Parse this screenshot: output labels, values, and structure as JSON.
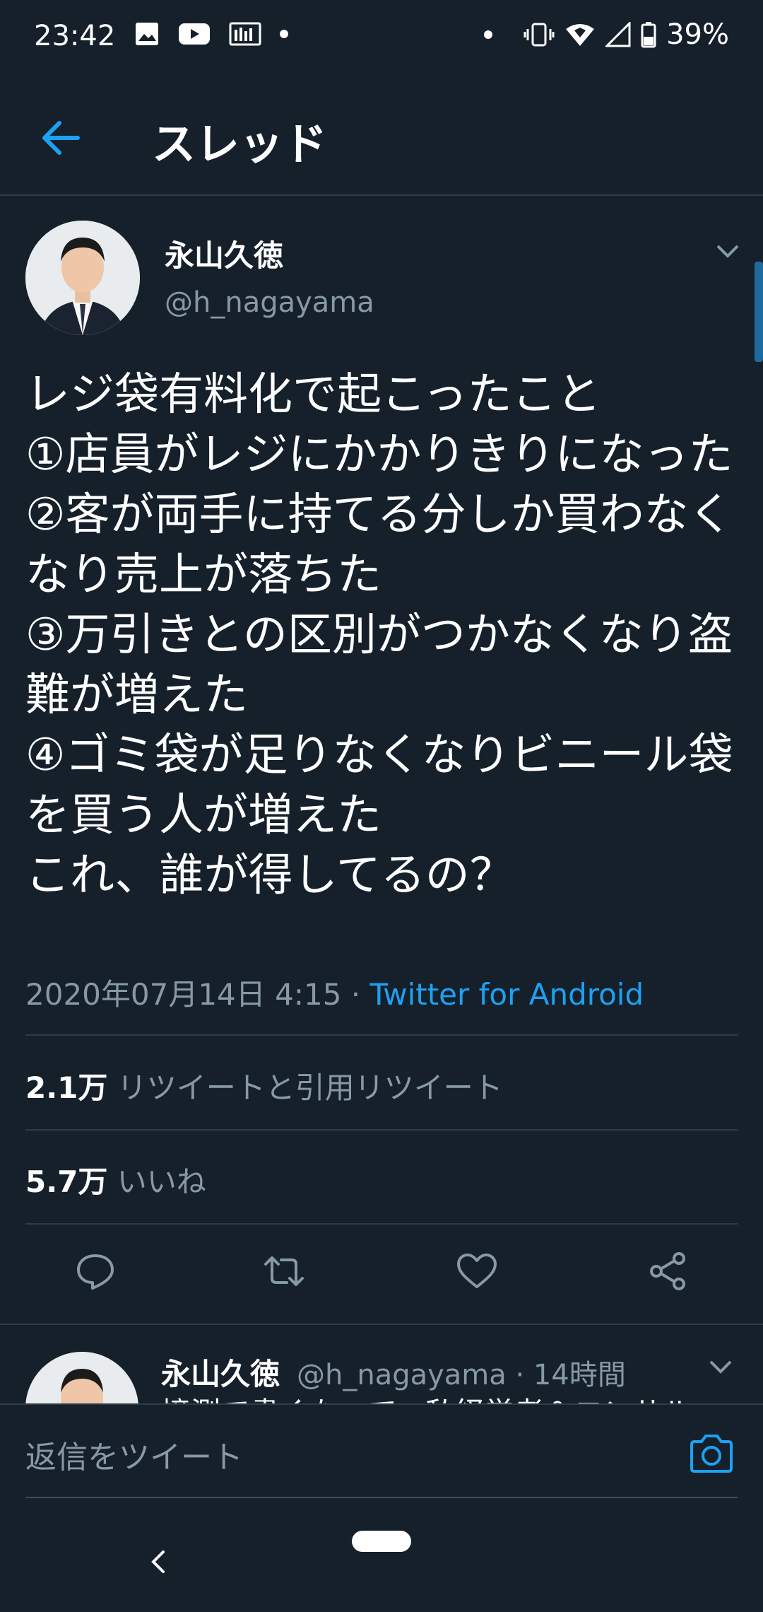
{
  "status_bar": {
    "time": "23:42",
    "battery": "39%"
  },
  "header": {
    "title": "スレッド"
  },
  "tweet": {
    "name": "永山久徳",
    "handle": "@h_nagayama",
    "text": "レジ袋有料化で起こったこと\n①店員がレジにかかりきりになった\n②客が両手に持てる分しか買わなくなり売上が落ちた\n③万引きとの区別がつかなくなり盗難が増えた\n④ゴミ袋が足りなくなりビニール袋を買う人が増えた\nこれ、誰が得してるの？",
    "timestamp": "2020年07月14日 4:15",
    "separator": " · ",
    "source": "Twitter for Android",
    "retweets_count": "2.1万",
    "retweets_label": " リツイートと引用リツイート",
    "likes_count": "5.7万",
    "likes_label": " いいね"
  },
  "reply_preview": {
    "name": "永山久徳",
    "handle_time": "@h_nagayama · 14時間",
    "snippet": "憶測で書くなって、私経営者＆コンサル"
  },
  "composer": {
    "placeholder": "返信をツイート"
  },
  "colors": {
    "background": "#15202b",
    "accent": "#1da1f2",
    "secondary_text": "#8899a6",
    "divider": "#2f3b47"
  }
}
